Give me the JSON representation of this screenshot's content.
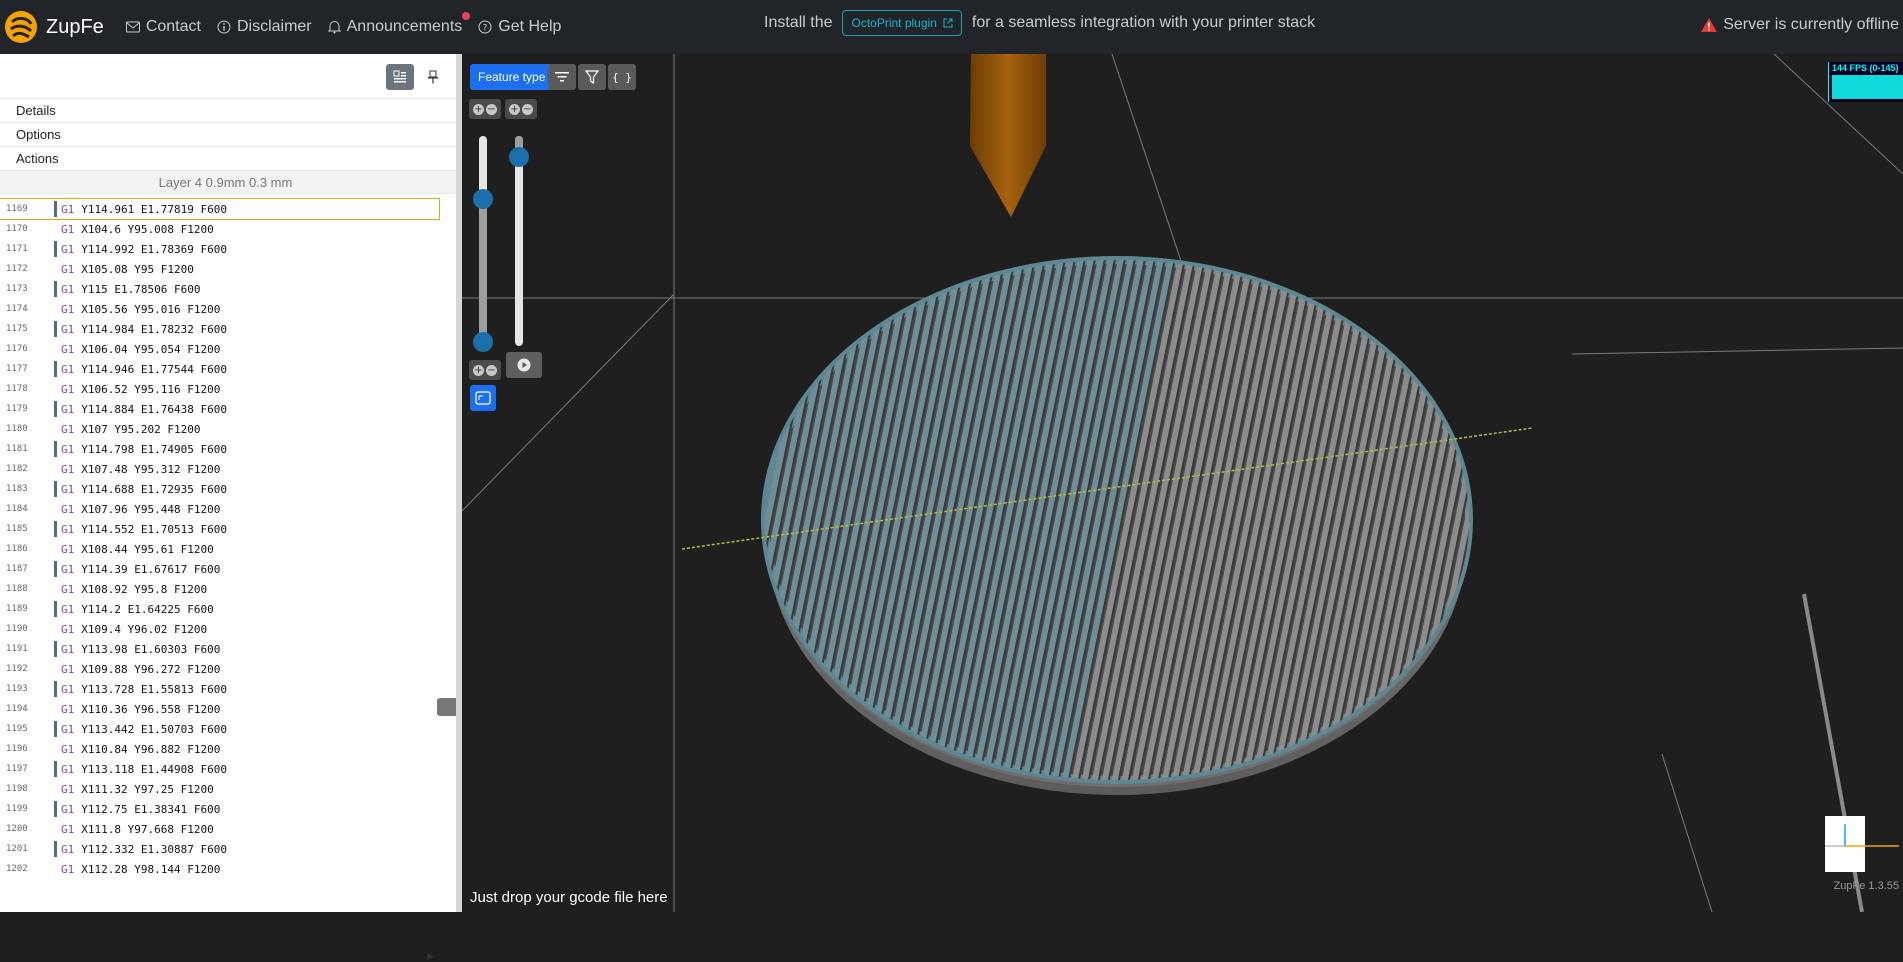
{
  "app": {
    "name": "ZupFe",
    "version": "ZupFe 1.3.55"
  },
  "nav": [
    {
      "label": "Contact",
      "icon": "mail-icon"
    },
    {
      "label": "Disclaimer",
      "icon": "info-circle-icon"
    },
    {
      "label": "Announcements",
      "icon": "bell-icon",
      "has_notification": true
    },
    {
      "label": "Get Help",
      "icon": "question-circle-icon"
    }
  ],
  "promo": {
    "prefix": "Install the",
    "button": "OctoPrint plugin",
    "suffix": "for a seamless integration with your printer stack"
  },
  "status": {
    "text": "Server is currently offline",
    "icon": "warning-triangle-icon",
    "color": "#e53935"
  },
  "panel": {
    "sections": [
      "Details",
      "Options",
      "Actions"
    ],
    "layer_info": "Layer 4  0.9mm  0.3 mm"
  },
  "gcode_lines": [
    {
      "ln": "1169",
      "cmd": "G1",
      "args": "Y114.961 E1.77819 F600",
      "type": "extrude",
      "selected": true
    },
    {
      "ln": "1170",
      "cmd": "G1",
      "args": "X104.6 Y95.008 F1200",
      "type": "travel"
    },
    {
      "ln": "1171",
      "cmd": "G1",
      "args": "Y114.992 E1.78369 F600",
      "type": "extrude"
    },
    {
      "ln": "1172",
      "cmd": "G1",
      "args": "X105.08 Y95 F1200",
      "type": "travel"
    },
    {
      "ln": "1173",
      "cmd": "G1",
      "args": "Y115 E1.78506 F600",
      "type": "extrude"
    },
    {
      "ln": "1174",
      "cmd": "G1",
      "args": "X105.56 Y95.016 F1200",
      "type": "travel"
    },
    {
      "ln": "1175",
      "cmd": "G1",
      "args": "Y114.984 E1.78232 F600",
      "type": "extrude"
    },
    {
      "ln": "1176",
      "cmd": "G1",
      "args": "X106.04 Y95.054 F1200",
      "type": "travel"
    },
    {
      "ln": "1177",
      "cmd": "G1",
      "args": "Y114.946 E1.77544 F600",
      "type": "extrude"
    },
    {
      "ln": "1178",
      "cmd": "G1",
      "args": "X106.52 Y95.116 F1200",
      "type": "travel"
    },
    {
      "ln": "1179",
      "cmd": "G1",
      "args": "Y114.884 E1.76438 F600",
      "type": "extrude"
    },
    {
      "ln": "1180",
      "cmd": "G1",
      "args": "X107 Y95.202 F1200",
      "type": "travel"
    },
    {
      "ln": "1181",
      "cmd": "G1",
      "args": "Y114.798 E1.74905 F600",
      "type": "extrude"
    },
    {
      "ln": "1182",
      "cmd": "G1",
      "args": "X107.48 Y95.312 F1200",
      "type": "travel"
    },
    {
      "ln": "1183",
      "cmd": "G1",
      "args": "Y114.688 E1.72935 F600",
      "type": "extrude"
    },
    {
      "ln": "1184",
      "cmd": "G1",
      "args": "X107.96 Y95.448 F1200",
      "type": "travel"
    },
    {
      "ln": "1185",
      "cmd": "G1",
      "args": "Y114.552 E1.70513 F600",
      "type": "extrude"
    },
    {
      "ln": "1186",
      "cmd": "G1",
      "args": "X108.44 Y95.61 F1200",
      "type": "travel"
    },
    {
      "ln": "1187",
      "cmd": "G1",
      "args": "Y114.39 E1.67617 F600",
      "type": "extrude"
    },
    {
      "ln": "1188",
      "cmd": "G1",
      "args": "X108.92 Y95.8 F1200",
      "type": "travel"
    },
    {
      "ln": "1189",
      "cmd": "G1",
      "args": "Y114.2 E1.64225 F600",
      "type": "extrude"
    },
    {
      "ln": "1190",
      "cmd": "G1",
      "args": "X109.4 Y96.02 F1200",
      "type": "travel"
    },
    {
      "ln": "1191",
      "cmd": "G1",
      "args": "Y113.98 E1.60303 F600",
      "type": "extrude"
    },
    {
      "ln": "1192",
      "cmd": "G1",
      "args": "X109.88 Y96.272 F1200",
      "type": "travel"
    },
    {
      "ln": "1193",
      "cmd": "G1",
      "args": "Y113.728 E1.55813 F600",
      "type": "extrude"
    },
    {
      "ln": "1194",
      "cmd": "G1",
      "args": "X110.36 Y96.558 F1200",
      "type": "travel"
    },
    {
      "ln": "1195",
      "cmd": "G1",
      "args": "Y113.442 E1.50703 F600",
      "type": "extrude"
    },
    {
      "ln": "1196",
      "cmd": "G1",
      "args": "X110.84 Y96.882 F1200",
      "type": "travel"
    },
    {
      "ln": "1197",
      "cmd": "G1",
      "args": "Y113.118 E1.44908 F600",
      "type": "extrude"
    },
    {
      "ln": "1198",
      "cmd": "G1",
      "args": "X111.32 Y97.25 F1200",
      "type": "travel"
    },
    {
      "ln": "1199",
      "cmd": "G1",
      "args": "Y112.75 E1.38341 F600",
      "type": "extrude"
    },
    {
      "ln": "1200",
      "cmd": "G1",
      "args": "X111.8 Y97.668 F1200",
      "type": "travel"
    },
    {
      "ln": "1201",
      "cmd": "G1",
      "args": "Y112.332 E1.30887 F600",
      "type": "extrude"
    },
    {
      "ln": "1202",
      "cmd": "G1",
      "args": "X112.28 Y98.144 F1200",
      "type": "travel"
    }
  ],
  "viewer": {
    "feature_type_label": "Feature type",
    "fps_label": "144 FPS (0-145)",
    "drop_hint": "Just drop your gcode file here",
    "layer_slider": {
      "min_fraction": 0.0,
      "max_fraction": 0.7
    },
    "move_slider": {
      "fraction": 0.9
    },
    "colors": {
      "accent": "#1d6ff2",
      "knob": "#1b6faa",
      "model_gray": "#7a7a7a",
      "outer_ring": "#5e8791",
      "nozzle": "#9b5a0e"
    }
  }
}
